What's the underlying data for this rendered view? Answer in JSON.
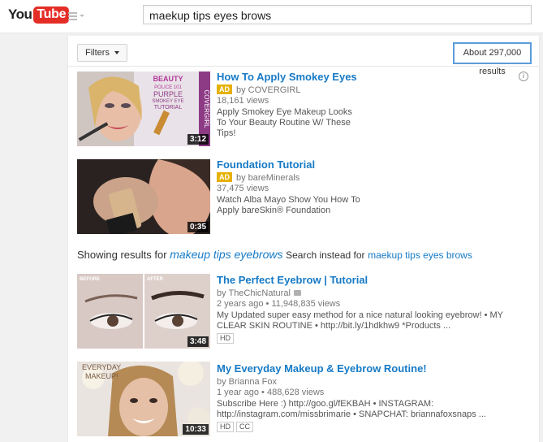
{
  "masthead": {
    "logo_you": "You",
    "logo_tube": "Tube",
    "search_query": "maekup tips eyes brows"
  },
  "toolbar": {
    "filters_label": "Filters",
    "result_count": "About 297,000 results"
  },
  "ads": [
    {
      "title": "How To Apply Smokey Eyes",
      "ad_label": "AD",
      "channel": "by COVERGIRL",
      "views": "18,161 views",
      "description": "Apply Smokey Eye Makeup Looks To Your Beauty Routine W/ These Tips!",
      "duration": "3:12",
      "thumb_text": {
        "beauty": "BEAUTY",
        "police": "POLICE 101",
        "purple": "PURPLE",
        "smokey": "SMOKEY EYE",
        "tutorial": "TUTORIAL",
        "brand": "COVERGIRL"
      }
    },
    {
      "title": "Foundation Tutorial",
      "ad_label": "AD",
      "channel": "by bareMinerals",
      "views": "37,475 views",
      "description": "Watch Alba Mayo Show You How To Apply bareSkin® Foundation",
      "duration": "0:35"
    }
  ],
  "correction": {
    "showing_prefix": "Showing results for",
    "corrected_query": "makeup tips eyebrows",
    "instead_prefix": "Search instead for",
    "original_query": "maekup tips eyes brows"
  },
  "videos": [
    {
      "title": "The Perfect Eyebrow | Tutorial",
      "channel": "by TheChicNatural",
      "age": "2 years ago",
      "views": "11,948,835 views",
      "description": "My Updated super easy method for a nice natural looking eyebrow! • MY CLEAR SKIN ROUTINE • http://bit.ly/1hdkhw9 *Products ...",
      "badges": [
        "HD"
      ],
      "duration": "3:48",
      "thumb_text": {
        "before": "BEFORE",
        "after": "AFTER"
      }
    },
    {
      "title": "My Everyday Makeup & Eyebrow Routine!",
      "channel": "by Brianna Fox",
      "age": "1 year ago",
      "views": "488,628 views",
      "description": "Subscribe Here :) http://goo.gl/fEKBAH • INSTAGRAM: http://instagram.com/missbrimarie • SNAPCHAT: briannafoxsnaps ...",
      "badges": [
        "HD",
        "CC"
      ],
      "duration": "10:33",
      "thumb_text": {
        "line1": "EVERYDAY",
        "line2": "MAKEUP!"
      }
    }
  ],
  "colors": {
    "brand_red": "#e52d27",
    "link_blue": "#167ac6",
    "ad_yellow": "#e5b100",
    "focus_blue": "#5b9dd9"
  }
}
